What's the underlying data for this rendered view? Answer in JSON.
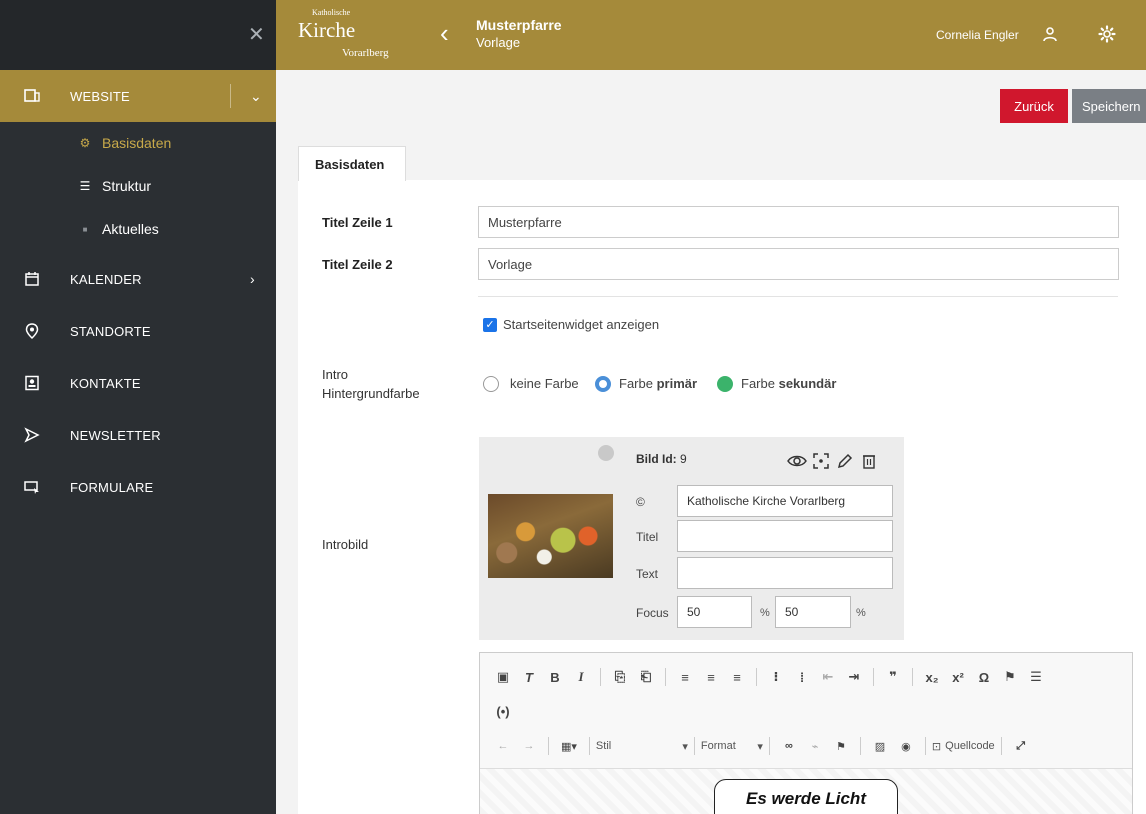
{
  "sidebar": {
    "close_icon": "close-icon",
    "nav": [
      {
        "label": "WEBSITE",
        "icon": "website-icon"
      },
      {
        "label": "KALENDER",
        "icon": "calendar-icon"
      },
      {
        "label": "STANDORTE",
        "icon": "location-icon"
      },
      {
        "label": "KONTAKTE",
        "icon": "contact-icon"
      },
      {
        "label": "NEWSLETTER",
        "icon": "send-icon"
      },
      {
        "label": "FORMULARE",
        "icon": "form-icon"
      }
    ],
    "website_sub": [
      {
        "label": "Basisdaten",
        "icon": "gear-icon"
      },
      {
        "label": "Struktur",
        "icon": "structure-icon"
      },
      {
        "label": "Aktuelles",
        "icon": "square-icon"
      }
    ]
  },
  "header": {
    "logo": {
      "line1": "Katholische",
      "line2": "Kirche",
      "line3": "Vorarlberg"
    },
    "title": "Musterpfarre",
    "subtitle": "Vorlage",
    "user_name": "Cornelia Engler"
  },
  "actions": {
    "back": "Zurück",
    "save": "Speichern"
  },
  "tabs": [
    {
      "label": "Basisdaten"
    }
  ],
  "form": {
    "titel1_label": "Titel Zeile 1",
    "titel1_value": "Musterpfarre",
    "titel2_label": "Titel Zeile 2",
    "titel2_value": "Vorlage",
    "widget_checkbox_label": "Startseitenwidget anzeigen",
    "intro_label_1": "Intro",
    "intro_label_2": "Hintergrundfarbe",
    "color_none": "keine Farbe",
    "color_primary_prefix": "Farbe",
    "color_primary_bold": "primär",
    "color_secondary_prefix": "Farbe",
    "color_secondary_bold": "sekundär",
    "introbild_label": "Introbild"
  },
  "image": {
    "id_label": "Bild Id:",
    "id_value": "9",
    "copyright_label": "©",
    "copyright_value": "Katholische Kirche Vorarlberg",
    "titel_label": "Titel",
    "titel_value": "",
    "text_label": "Text",
    "text_value": "",
    "focus_label": "Focus",
    "focus_x": "50",
    "focus_y": "50",
    "percent": "%"
  },
  "editor": {
    "style_label": "Stil",
    "format_label": "Format",
    "source_label": "Quellcode",
    "content_preview": "Es werde Licht"
  },
  "colors": {
    "gold": "#a58a3a",
    "sidebar": "#2b2f33",
    "danger": "#d0172d",
    "secondary": "#7a7f85",
    "green": "#3bb36b",
    "blue": "#4a8fd8"
  }
}
